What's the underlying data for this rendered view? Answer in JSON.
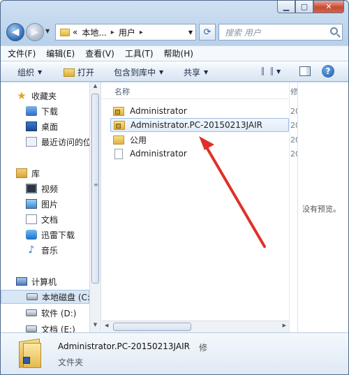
{
  "address": {
    "segments": [
      "«",
      "本地...",
      "▸",
      "用户",
      "▸"
    ]
  },
  "search": {
    "placeholder": "搜索 用户"
  },
  "menubar": [
    "文件(F)",
    "编辑(E)",
    "查看(V)",
    "工具(T)",
    "帮助(H)"
  ],
  "toolbar": {
    "organize": "组织",
    "open": "打开",
    "include_in_library": "包含到库中",
    "share": "共享"
  },
  "nav": {
    "favorites_label": "收藏夹",
    "favorites": [
      "下载",
      "桌面",
      "最近访问的位"
    ],
    "libraries_label": "库",
    "libraries": [
      "视频",
      "图片",
      "文档",
      "迅雷下载",
      "音乐"
    ],
    "computer_label": "计算机",
    "drives": [
      "本地磁盘 (C:)",
      "软件 (D:)",
      "文档 (E:)"
    ]
  },
  "columns": {
    "name": "名称",
    "modified_partial": "修"
  },
  "files": [
    {
      "name": "Administrator",
      "modified_partial": "20"
    },
    {
      "name": "Administrator.PC-20150213JAIR",
      "modified_partial": "20"
    },
    {
      "name": "公用",
      "modified_partial": "20"
    },
    {
      "name": "Administrator",
      "modified_partial": "20"
    }
  ],
  "preview": {
    "empty_text": "没有预览。"
  },
  "details": {
    "name": "Administrator.PC-20150213JAIR",
    "modified_label": "修",
    "type": "文件夹"
  },
  "colors": {
    "annotation_arrow": "#e0302a",
    "accent": "#3c6fb0"
  },
  "icons": [
    "back-arrow-icon",
    "forward-arrow-icon",
    "refresh-icon",
    "search-icon",
    "help-icon",
    "folder-icon",
    "locked-folder-icon",
    "star-icon"
  ]
}
